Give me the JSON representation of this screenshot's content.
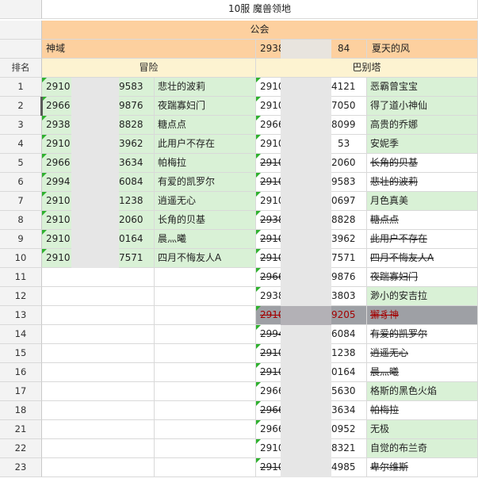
{
  "title": "10服 魔兽领地",
  "guild_header": "公会",
  "guild_row": {
    "left_name": "神域",
    "right_id": "2938",
    "right_id_tail": "84",
    "right_name": "夏天的风"
  },
  "col_headers": {
    "rank": "排名",
    "left": "冒险",
    "right": "巴别塔"
  },
  "rows": [
    {
      "rank": "1",
      "l_id": "2910",
      "l_tail": "9583",
      "l_name": "悲壮的波莉",
      "r_id": "2910",
      "r_tail": "4121",
      "r_name": "恶霸曾宝宝"
    },
    {
      "rank": "2",
      "l_id": "2966",
      "l_tail": "9876",
      "l_name": "夜踹寡妇门",
      "r_id": "2910",
      "r_tail": "7050",
      "r_name": "得了道小神仙"
    },
    {
      "rank": "3",
      "l_id": "2938",
      "l_tail": "8828",
      "l_name": "糖点点",
      "r_id": "2966",
      "r_tail": "8099",
      "r_name": "高贵的乔娜"
    },
    {
      "rank": "4",
      "l_id": "2910",
      "l_tail": "3962",
      "l_name": "此用户不存在",
      "r_id": "2910",
      "r_tail": "53",
      "r_name": "安妮季"
    },
    {
      "rank": "5",
      "l_id": "2966",
      "l_tail": "3634",
      "l_name": "帕梅拉",
      "r_id": "2910",
      "r_tail": "2060",
      "r_name": "长角的贝基"
    },
    {
      "rank": "6",
      "l_id": "2994",
      "l_tail": "6084",
      "l_name": "有爱的凯罗尔",
      "r_id": "2910",
      "r_tail": "9583",
      "r_name": "悲壮的波莉"
    },
    {
      "rank": "7",
      "l_id": "2910",
      "l_tail": "1238",
      "l_name": "逍遥无心",
      "r_id": "2910",
      "r_tail": "0697",
      "r_name": "月色真美"
    },
    {
      "rank": "8",
      "l_id": "2910",
      "l_tail": "2060",
      "l_name": "长角的贝基",
      "r_id": "2938",
      "r_tail": "8828",
      "r_name": "糖点点"
    },
    {
      "rank": "9",
      "l_id": "2910",
      "l_tail": "0164",
      "l_name": "晨灬曦",
      "r_id": "2910",
      "r_tail": "3962",
      "r_name": "此用户不存在"
    },
    {
      "rank": "10",
      "l_id": "2910",
      "l_tail": "7571",
      "l_name": "四月不悔友人A",
      "r_id": "2910",
      "r_tail": "7571",
      "r_name": "四月不悔友人A"
    },
    {
      "rank": "11",
      "l_id": "",
      "l_tail": "",
      "l_name": "",
      "r_id": "2966",
      "r_tail": "9876",
      "r_name": "夜踹寡妇门"
    },
    {
      "rank": "12",
      "l_id": "",
      "l_tail": "",
      "l_name": "",
      "r_id": "2938",
      "r_tail": "3803",
      "r_name": "渺小的安吉拉"
    },
    {
      "rank": "13",
      "l_id": "",
      "l_tail": "",
      "l_name": "",
      "r_id": "2910",
      "r_tail": "9205",
      "r_name": "獬豸神"
    },
    {
      "rank": "14",
      "l_id": "",
      "l_tail": "",
      "l_name": "",
      "r_id": "2994",
      "r_tail": "6084",
      "r_name": "有爱的凯罗尔"
    },
    {
      "rank": "15",
      "l_id": "",
      "l_tail": "",
      "l_name": "",
      "r_id": "2910",
      "r_tail": "1238",
      "r_name": "逍遥无心"
    },
    {
      "rank": "16",
      "l_id": "",
      "l_tail": "",
      "l_name": "",
      "r_id": "2910",
      "r_tail": "0164",
      "r_name": "晨灬曦"
    },
    {
      "rank": "17",
      "l_id": "",
      "l_tail": "",
      "l_name": "",
      "r_id": "2966",
      "r_tail": "5630",
      "r_name": "格斯的黑色火焰"
    },
    {
      "rank": "18",
      "l_id": "",
      "l_tail": "",
      "l_name": "",
      "r_id": "2966",
      "r_tail": "3634",
      "r_name": "帕梅拉"
    },
    {
      "rank": "21",
      "l_id": "",
      "l_tail": "",
      "l_name": "",
      "r_id": "2966",
      "r_tail": "0952",
      "r_name": "无极"
    },
    {
      "rank": "22",
      "l_id": "",
      "l_tail": "",
      "l_name": "",
      "r_id": "2910",
      "r_tail": "8321",
      "r_name": "自觉的布兰奇"
    },
    {
      "rank": "23",
      "l_id": "",
      "l_tail": "",
      "l_name": "",
      "r_id": "2910",
      "r_tail": "4985",
      "r_name": "卑尔维斯"
    }
  ],
  "colors": {
    "green": "#d9f1d6",
    "orange": "#fdd09f",
    "yellow": "#fdf3d1",
    "grey": "#9ea0a5",
    "marker": "#2fb12f"
  }
}
